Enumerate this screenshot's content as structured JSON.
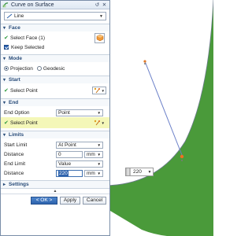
{
  "window": {
    "title": "Curve on Surface"
  },
  "type_select": {
    "value": "Line"
  },
  "sections": {
    "face": {
      "header": "Face",
      "select_label": "Select Face (1)",
      "keep_selected_label": "Keep Selected",
      "keep_selected_checked": true
    },
    "mode": {
      "header": "Mode",
      "options": [
        "Projection",
        "Geodesic"
      ],
      "selected": "Projection"
    },
    "start": {
      "header": "Start",
      "select_label": "Select Point"
    },
    "end": {
      "header": "End",
      "option_label": "End Option",
      "option_value": "Point",
      "select_label": "Select Point"
    },
    "limits": {
      "header": "Limits",
      "start_limit_label": "Start Limit",
      "start_limit_value": "At Point",
      "distance1_label": "Distance",
      "distance1_value": "0",
      "distance1_unit": "mm",
      "end_limit_label": "End Limit",
      "end_limit_value": "Value",
      "distance2_label": "Distance",
      "distance2_value": "220",
      "distance2_unit": "mm"
    },
    "settings": {
      "header": "Settings"
    }
  },
  "buttons": {
    "ok": "< OK >",
    "apply": "Apply",
    "cancel": "Cancel"
  },
  "viewport": {
    "dimension_value": "220"
  },
  "colors": {
    "surface": "#4a9a3a",
    "accent": "#2f63ad",
    "highlight": "#f4f7b8"
  }
}
